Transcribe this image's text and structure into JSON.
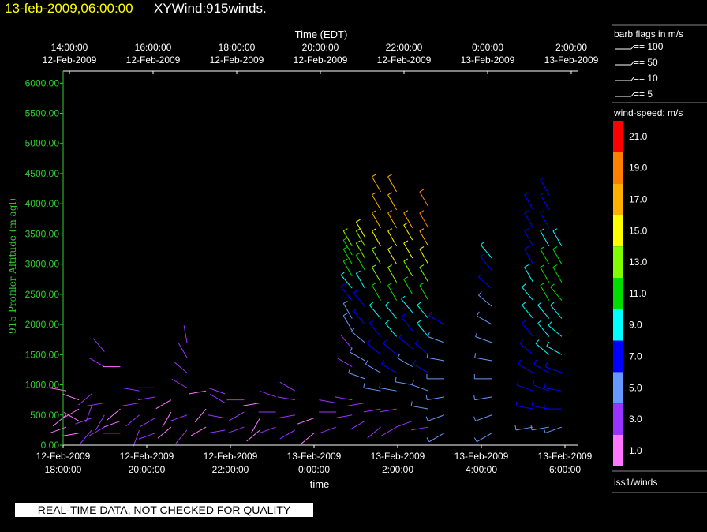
{
  "header": {
    "date": "13-feb-2009,06:00:00",
    "product": "XYWind:915winds."
  },
  "notice": "REAL-TIME DATA, NOT CHECKED FOR QUALITY",
  "legend": {
    "barb_title": "barb flags in m/s",
    "barbs": [
      "== 100",
      "== 50",
      "== 10",
      "== 5"
    ],
    "speed_title": "wind-speed: m/s",
    "scale": [
      {
        "label": "21.0",
        "color": "#ff0000"
      },
      {
        "label": "19.0",
        "color": "#ff8000"
      },
      {
        "label": "17.0",
        "color": "#ffb000"
      },
      {
        "label": "15.0",
        "color": "#ffff00"
      },
      {
        "label": "13.0",
        "color": "#80ff00"
      },
      {
        "label": "11.0",
        "color": "#00dd00"
      },
      {
        "label": "9.0",
        "color": "#00ffff"
      },
      {
        "label": "7.0",
        "color": "#0000ff"
      },
      {
        "label": "5.0",
        "color": "#6699ff"
      },
      {
        "label": "3.0",
        "color": "#9933ff"
      },
      {
        "label": "1.0",
        "color": "#ff77ff"
      }
    ],
    "source": "iss1/winds"
  },
  "chart_data": {
    "type": "scatter",
    "marker": "wind-barb",
    "ylabel": "915 Profiler Altitude (m agl)",
    "ylim": [
      0,
      6200
    ],
    "yticks": [
      "0.00",
      "500.00",
      "1000.00",
      "1500.00",
      "2000.00",
      "2500.00",
      "3000.00",
      "3500.00",
      "4000.00",
      "4500.00",
      "5000.00",
      "5500.00",
      "6000.00"
    ],
    "top_axis": {
      "title": "Time (EDT)",
      "ticks": [
        {
          "time": "14:00:00",
          "date": "12-Feb-2009"
        },
        {
          "time": "16:00:00",
          "date": "12-Feb-2009"
        },
        {
          "time": "18:00:00",
          "date": "12-Feb-2009"
        },
        {
          "time": "20:00:00",
          "date": "12-Feb-2009"
        },
        {
          "time": "22:00:00",
          "date": "12-Feb-2009"
        },
        {
          "time": "0:00:00",
          "date": "13-Feb-2009"
        },
        {
          "time": "2:00:00",
          "date": "13-Feb-2009"
        }
      ]
    },
    "bottom_axis": {
      "title": "time",
      "ticks": [
        {
          "date": "12-Feb-2009",
          "time": "18:00:00"
        },
        {
          "date": "12-Feb-2009",
          "time": "20:00:00"
        },
        {
          "date": "12-Feb-2009",
          "time": "22:00:00"
        },
        {
          "date": "13-Feb-2009",
          "time": "0:00:00"
        },
        {
          "date": "13-Feb-2009",
          "time": "2:00:00"
        },
        {
          "date": "13-Feb-2009",
          "time": "4:00:00"
        },
        {
          "date": "13-Feb-2009",
          "time": "6:00:00"
        }
      ]
    },
    "xlim": [
      "2009-02-12T17:00:00",
      "2009-02-13T06:30:00"
    ],
    "profiles": [
      {
        "time": "2009-02-12T17:05:00",
        "barbs": [
          [
            300,
            2,
            250
          ],
          [
            500,
            2,
            230
          ],
          [
            700,
            2,
            270
          ],
          [
            900,
            2,
            280
          ]
        ]
      },
      {
        "time": "2009-02-12T17:25:00",
        "barbs": [
          [
            200,
            2,
            260
          ],
          [
            400,
            2,
            300
          ],
          [
            600,
            2,
            240
          ],
          [
            750,
            2,
            290
          ]
        ]
      },
      {
        "time": "2009-02-12T17:45:00",
        "barbs": [
          [
            250,
            3,
            220
          ],
          [
            450,
            3,
            250
          ],
          [
            650,
            3,
            200
          ],
          [
            850,
            3,
            230
          ]
        ]
      },
      {
        "time": "2009-02-12T18:05:00",
        "barbs": [
          [
            300,
            3,
            240
          ],
          [
            500,
            3,
            210
          ],
          [
            700,
            3,
            260
          ],
          [
            1300,
            3,
            300
          ],
          [
            1550,
            3,
            320
          ]
        ]
      },
      {
        "time": "2009-02-12T18:30:00",
        "barbs": [
          [
            200,
            2,
            270
          ],
          [
            400,
            2,
            250
          ],
          [
            600,
            2,
            230
          ],
          [
            1300,
            2,
            270
          ]
        ]
      },
      {
        "time": "2009-02-12T19:00:00",
        "barbs": [
          [
            250,
            3,
            200
          ],
          [
            500,
            3,
            230
          ],
          [
            700,
            3,
            260
          ],
          [
            900,
            3,
            280
          ]
        ]
      },
      {
        "time": "2009-02-12T19:25:00",
        "barbs": [
          [
            200,
            3,
            250
          ],
          [
            450,
            3,
            240
          ],
          [
            800,
            3,
            260
          ],
          [
            950,
            3,
            270
          ]
        ]
      },
      {
        "time": "2009-02-12T19:50:00",
        "barbs": [
          [
            300,
            2,
            230
          ],
          [
            550,
            2,
            210
          ],
          [
            750,
            2,
            240
          ]
        ]
      },
      {
        "time": "2009-02-12T20:15:00",
        "barbs": [
          [
            250,
            3,
            220
          ],
          [
            500,
            3,
            250
          ],
          [
            700,
            3,
            270
          ],
          [
            950,
            3,
            300
          ],
          [
            1200,
            3,
            310
          ],
          [
            1450,
            3,
            330
          ],
          [
            1700,
            3,
            350
          ]
        ]
      },
      {
        "time": "2009-02-12T20:45:00",
        "barbs": [
          [
            300,
            2,
            240
          ],
          [
            600,
            2,
            220
          ],
          [
            900,
            2,
            260
          ]
        ]
      },
      {
        "time": "2009-02-12T21:15:00",
        "barbs": [
          [
            250,
            3,
            260
          ],
          [
            450,
            3,
            280
          ],
          [
            700,
            3,
            300
          ],
          [
            850,
            3,
            290
          ]
        ]
      },
      {
        "time": "2009-02-12T21:45:00",
        "barbs": [
          [
            300,
            3,
            250
          ],
          [
            550,
            3,
            240
          ],
          [
            750,
            3,
            270
          ]
        ]
      },
      {
        "time": "2009-02-12T22:10:00",
        "barbs": [
          [
            250,
            2,
            230
          ],
          [
            450,
            2,
            210
          ],
          [
            700,
            2,
            260
          ]
        ]
      },
      {
        "time": "2009-02-12T22:35:00",
        "barbs": [
          [
            300,
            3,
            250
          ],
          [
            550,
            3,
            270
          ],
          [
            800,
            3,
            290
          ]
        ]
      },
      {
        "time": "2009-02-12T23:05:00",
        "barbs": [
          [
            250,
            3,
            240
          ],
          [
            500,
            3,
            260
          ],
          [
            750,
            3,
            280
          ],
          [
            900,
            3,
            300
          ]
        ]
      },
      {
        "time": "2009-02-12T23:35:00",
        "barbs": [
          [
            200,
            2,
            230
          ],
          [
            450,
            2,
            250
          ],
          [
            700,
            2,
            270
          ]
        ]
      },
      {
        "time": "2009-02-13T00:10:00",
        "barbs": [
          [
            300,
            3,
            250
          ],
          [
            550,
            3,
            270
          ],
          [
            700,
            3,
            280
          ]
        ]
      },
      {
        "time": "2009-02-13T00:35:00",
        "barbs": [
          [
            500,
            4,
            260
          ],
          [
            750,
            4,
            280
          ],
          [
            1300,
            4,
            300
          ],
          [
            1600,
            4,
            320
          ],
          [
            1900,
            5,
            330
          ],
          [
            2100,
            6,
            330
          ],
          [
            2400,
            7,
            320
          ],
          [
            2600,
            9,
            320
          ],
          [
            2800,
            11,
            330
          ],
          [
            3000,
            12,
            330
          ],
          [
            3150,
            12,
            330
          ],
          [
            3300,
            13,
            330
          ]
        ]
      },
      {
        "time": "2009-02-13T00:55:00",
        "barbs": [
          [
            400,
            3,
            240
          ],
          [
            700,
            4,
            260
          ],
          [
            1100,
            5,
            290
          ],
          [
            1400,
            5,
            300
          ],
          [
            1700,
            6,
            310
          ],
          [
            2000,
            7,
            320
          ],
          [
            2300,
            8,
            320
          ],
          [
            2600,
            10,
            330
          ],
          [
            2900,
            12,
            330
          ],
          [
            3100,
            13,
            330
          ],
          [
            3300,
            14,
            330
          ],
          [
            3450,
            15,
            330
          ]
        ]
      },
      {
        "time": "2009-02-13T01:20:00",
        "barbs": [
          [
            300,
            3,
            230
          ],
          [
            600,
            4,
            260
          ],
          [
            900,
            5,
            280
          ],
          [
            1200,
            6,
            300
          ],
          [
            1500,
            7,
            310
          ],
          [
            1800,
            8,
            320
          ],
          [
            2100,
            9,
            320
          ],
          [
            2400,
            11,
            330
          ],
          [
            2700,
            13,
            330
          ],
          [
            3000,
            14,
            330
          ],
          [
            3300,
            16,
            330
          ],
          [
            3600,
            17,
            330
          ],
          [
            3900,
            18,
            330
          ],
          [
            4200,
            18,
            330
          ]
        ]
      },
      {
        "time": "2009-02-13T01:45:00",
        "barbs": [
          [
            300,
            3,
            240
          ],
          [
            600,
            4,
            260
          ],
          [
            900,
            5,
            280
          ],
          [
            1200,
            7,
            300
          ],
          [
            1500,
            8,
            310
          ],
          [
            1800,
            9,
            320
          ],
          [
            2100,
            10,
            320
          ],
          [
            2400,
            11,
            330
          ],
          [
            2700,
            13,
            330
          ],
          [
            3000,
            15,
            330
          ],
          [
            3300,
            16,
            330
          ],
          [
            3600,
            17,
            330
          ],
          [
            3900,
            18,
            330
          ],
          [
            4200,
            18,
            330
          ]
        ]
      },
      {
        "time": "2009-02-13T02:10:00",
        "barbs": [
          [
            400,
            3,
            250
          ],
          [
            700,
            4,
            270
          ],
          [
            1000,
            5,
            280
          ],
          [
            1300,
            6,
            300
          ],
          [
            1600,
            7,
            310
          ],
          [
            1900,
            8,
            320
          ],
          [
            2200,
            9,
            320
          ],
          [
            2500,
            11,
            330
          ],
          [
            2800,
            13,
            330
          ],
          [
            3100,
            15,
            330
          ],
          [
            3400,
            16,
            330
          ],
          [
            3600,
            17,
            330
          ]
        ]
      },
      {
        "time": "2009-02-13T02:35:00",
        "barbs": [
          [
            300,
            4,
            260
          ],
          [
            600,
            5,
            280
          ],
          [
            900,
            6,
            290
          ],
          [
            1200,
            7,
            300
          ],
          [
            1500,
            8,
            310
          ],
          [
            1800,
            9,
            320
          ],
          [
            2100,
            10,
            320
          ],
          [
            2400,
            12,
            330
          ],
          [
            2700,
            14,
            330
          ],
          [
            3000,
            16,
            330
          ],
          [
            3300,
            18,
            330
          ],
          [
            3600,
            19,
            330
          ],
          [
            3950,
            19,
            330
          ]
        ]
      },
      {
        "time": "2009-02-13T03:00:00",
        "barbs": [
          [
            200,
            5,
            240
          ],
          [
            500,
            5,
            250
          ],
          [
            800,
            6,
            260
          ],
          [
            1100,
            6,
            270
          ],
          [
            1400,
            6,
            280
          ],
          [
            1700,
            6,
            290
          ],
          [
            2000,
            7,
            300
          ]
        ]
      },
      {
        "time": "2009-02-13T04:15:00",
        "barbs": [
          [
            200,
            5,
            240
          ],
          [
            500,
            5,
            250
          ],
          [
            800,
            5,
            260
          ],
          [
            1100,
            6,
            270
          ],
          [
            1400,
            6,
            280
          ],
          [
            1700,
            6,
            290
          ],
          [
            2000,
            6,
            300
          ],
          [
            2300,
            6,
            310
          ],
          [
            2600,
            7,
            310
          ],
          [
            2900,
            8,
            320
          ],
          [
            3100,
            9,
            320
          ]
        ]
      },
      {
        "time": "2009-02-13T05:20:00",
        "barbs": [
          [
            300,
            5,
            260
          ],
          [
            600,
            7,
            280
          ],
          [
            900,
            8,
            290
          ],
          [
            1200,
            8,
            300
          ],
          [
            1500,
            8,
            310
          ],
          [
            1800,
            8,
            320
          ],
          [
            2100,
            9,
            320
          ],
          [
            2400,
            9,
            320
          ],
          [
            2700,
            10,
            330
          ],
          [
            3000,
            8,
            330
          ],
          [
            3300,
            7,
            330
          ],
          [
            3600,
            7,
            330
          ],
          [
            3900,
            7,
            330
          ]
        ]
      },
      {
        "time": "2009-02-13T05:45:00",
        "barbs": [
          [
            300,
            6,
            260
          ],
          [
            600,
            7,
            280
          ],
          [
            900,
            8,
            290
          ],
          [
            1200,
            8,
            300
          ],
          [
            1500,
            9,
            310
          ],
          [
            1800,
            9,
            320
          ],
          [
            2100,
            10,
            320
          ],
          [
            2400,
            11,
            330
          ],
          [
            2700,
            12,
            330
          ],
          [
            3000,
            12,
            330
          ],
          [
            3300,
            10,
            330
          ],
          [
            3600,
            8,
            330
          ],
          [
            3900,
            7,
            330
          ],
          [
            4150,
            7,
            330
          ]
        ]
      },
      {
        "time": "2009-02-13T06:05:00",
        "barbs": [
          [
            300,
            6,
            250
          ],
          [
            600,
            7,
            270
          ],
          [
            900,
            8,
            280
          ],
          [
            1200,
            8,
            290
          ],
          [
            1500,
            9,
            300
          ],
          [
            1800,
            9,
            310
          ],
          [
            2100,
            10,
            320
          ],
          [
            2400,
            11,
            320
          ],
          [
            2700,
            12,
            330
          ],
          [
            3000,
            12,
            330
          ],
          [
            3300,
            10,
            330
          ]
        ]
      }
    ]
  }
}
